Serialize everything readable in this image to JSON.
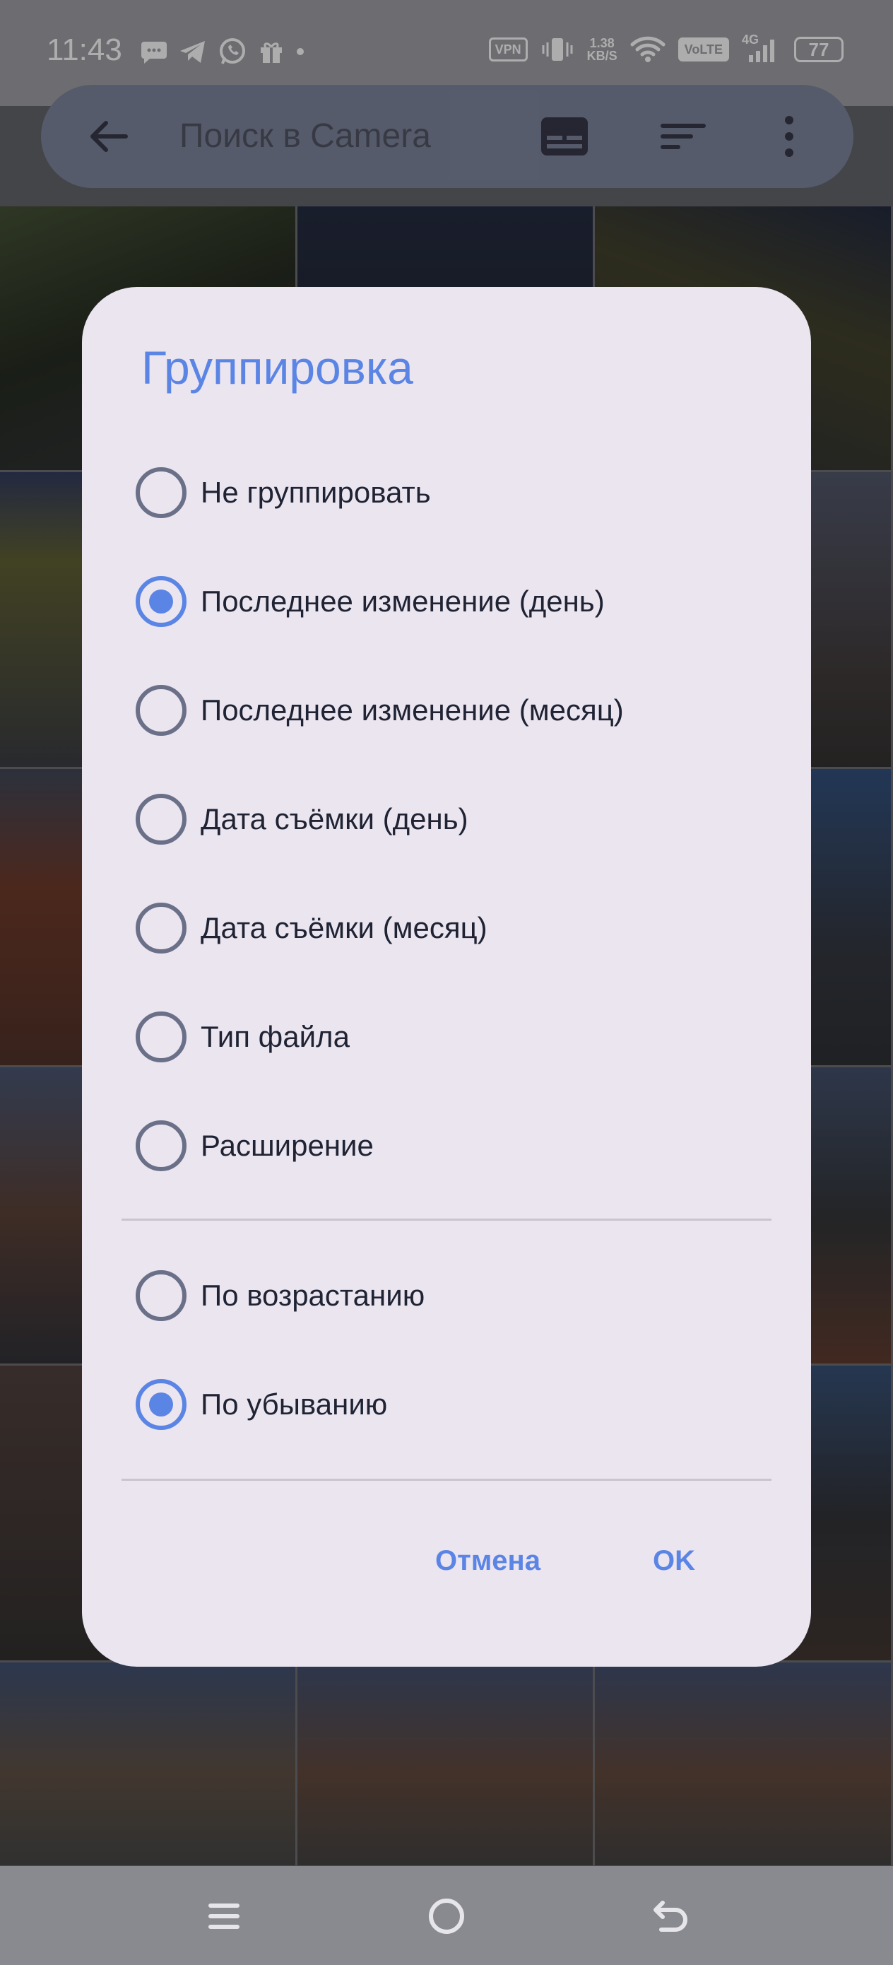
{
  "status_bar": {
    "time": "11:43",
    "vpn": "VPN",
    "speed_value": "1.38",
    "speed_unit": "KB/S",
    "volte": "VoLTE",
    "network": "4G",
    "battery": "77"
  },
  "search_bar": {
    "placeholder": "Поиск в Camera"
  },
  "dialog": {
    "title": "Группировка",
    "group_options": [
      {
        "label": "Не группировать",
        "checked": false
      },
      {
        "label": "Последнее изменение (день)",
        "checked": true
      },
      {
        "label": "Последнее изменение (месяц)",
        "checked": false
      },
      {
        "label": "Дата съёмки (день)",
        "checked": false
      },
      {
        "label": "Дата съёмки (месяц)",
        "checked": false
      },
      {
        "label": "Тип файла",
        "checked": false
      },
      {
        "label": "Расширение",
        "checked": false
      }
    ],
    "order_options": [
      {
        "label": "По возрастанию",
        "checked": false
      },
      {
        "label": "По убыванию",
        "checked": true
      }
    ],
    "cancel_label": "Отмена",
    "ok_label": "OK"
  },
  "colors": {
    "accent": "#5b85e5",
    "dialog_bg": "#ebe5f0",
    "radio_unchecked": "#6b7089"
  }
}
